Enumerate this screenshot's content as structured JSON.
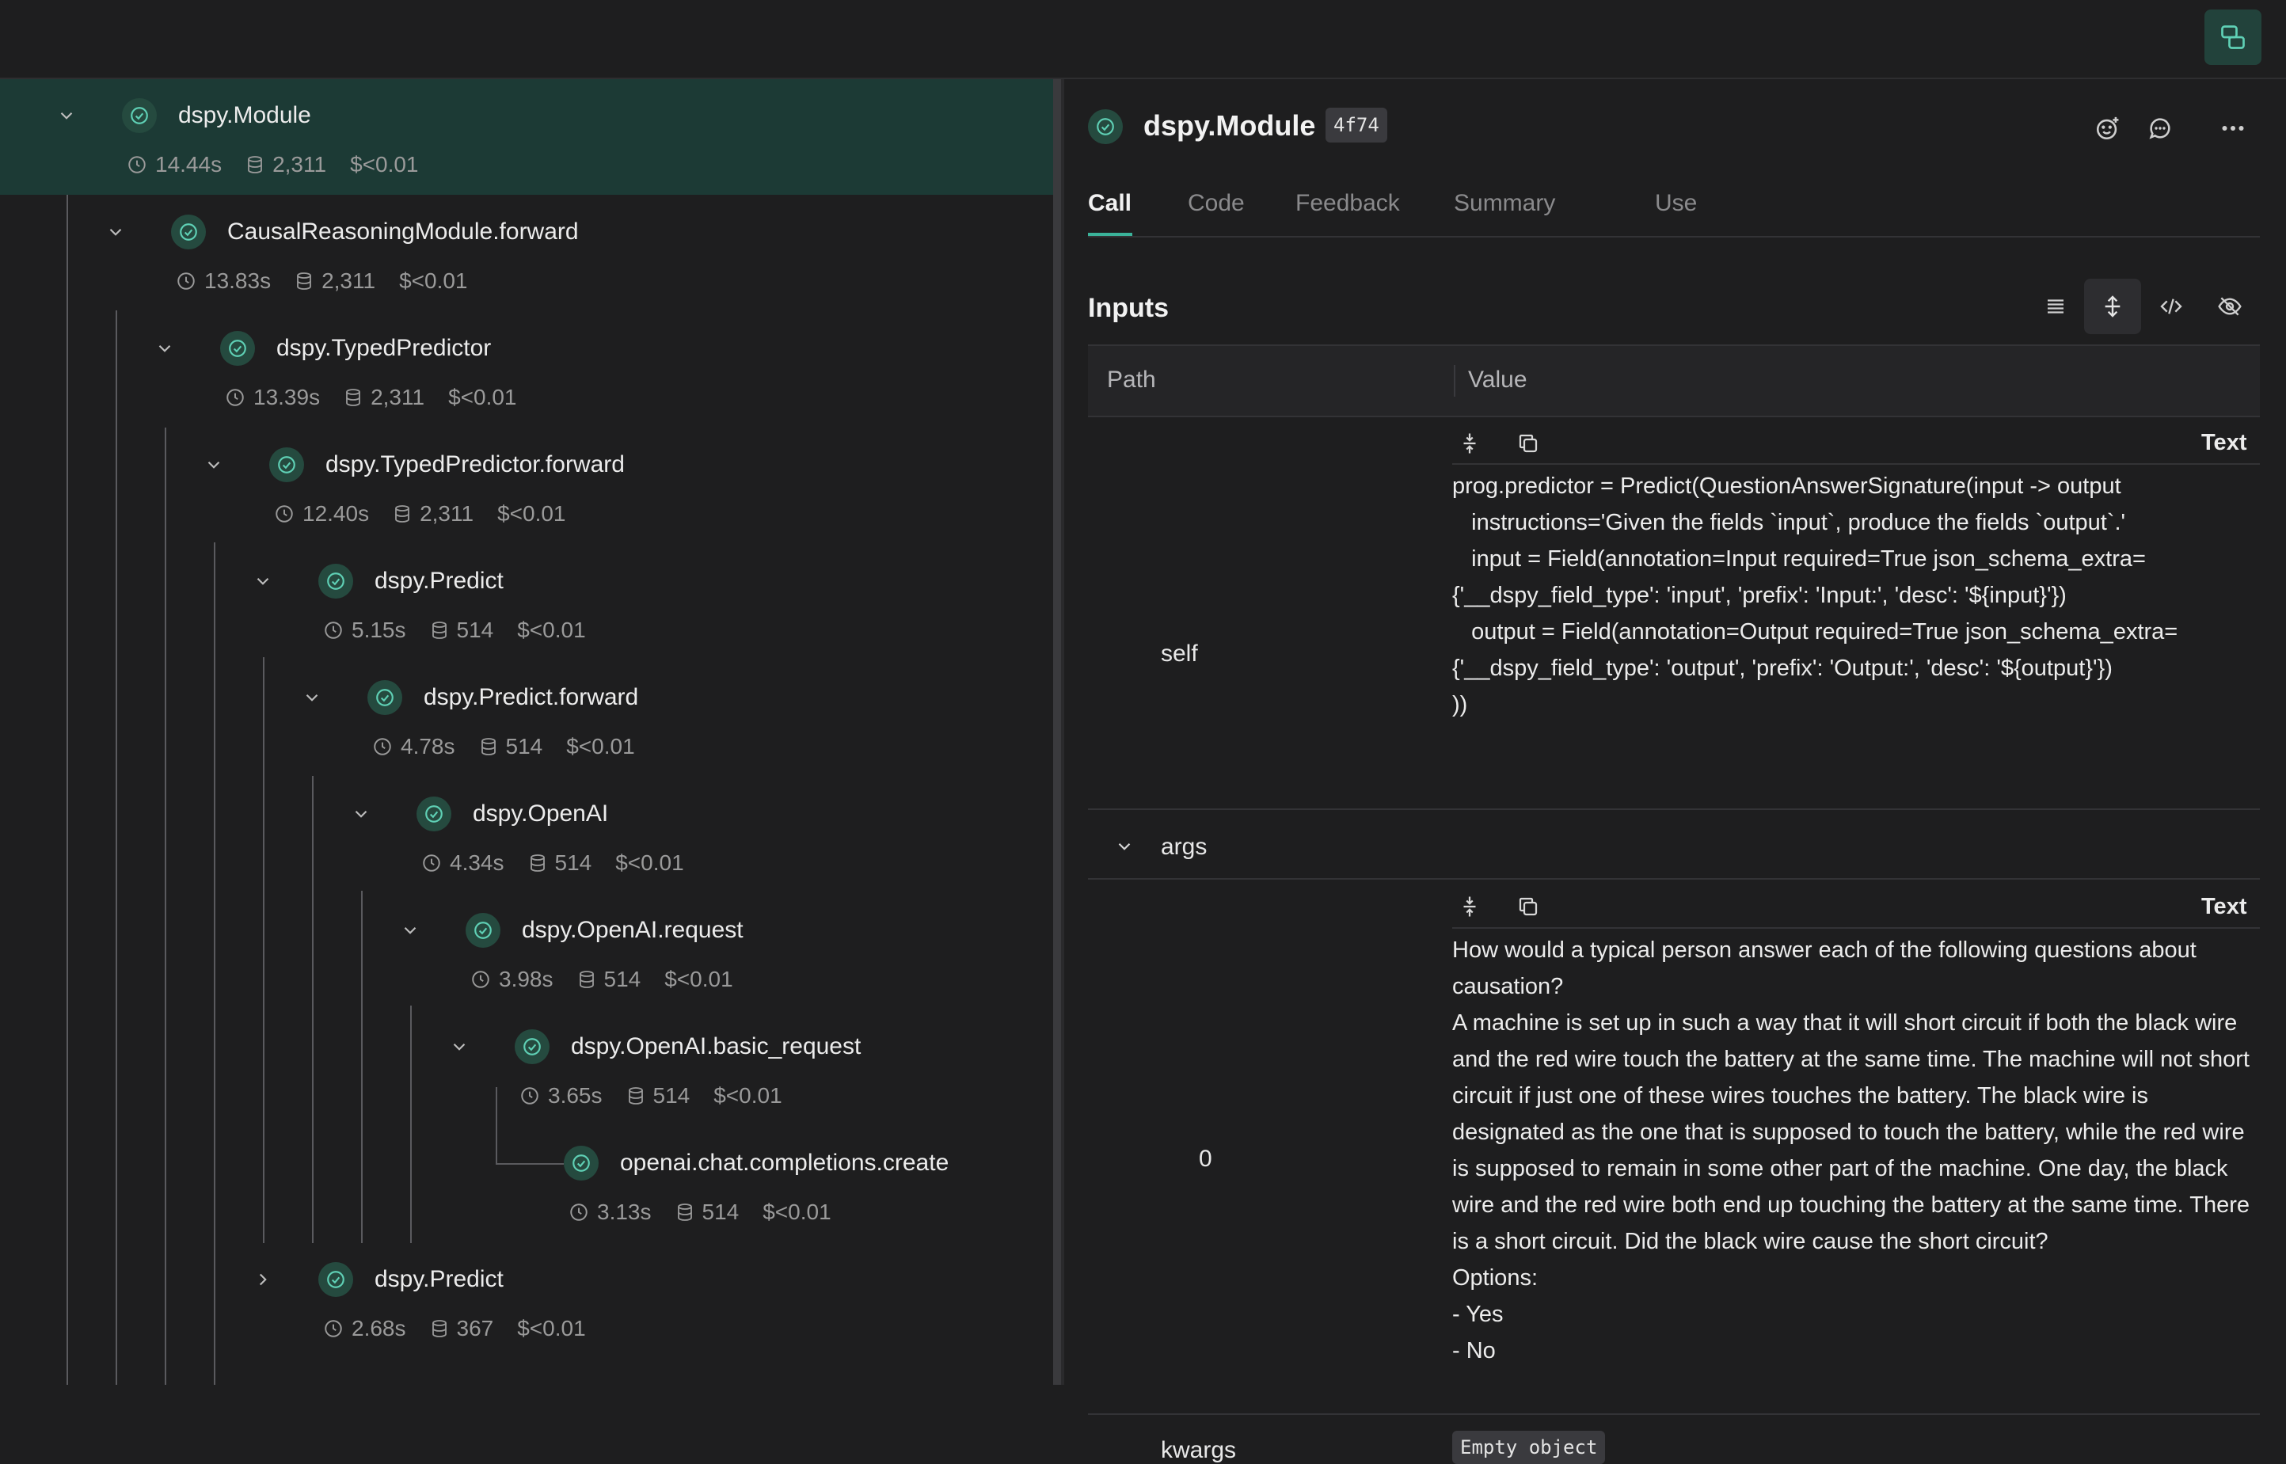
{
  "tree": {
    "nodes": [
      {
        "name": "dspy.Module",
        "time": "14.44s",
        "tokens": "2,311",
        "cost": "$<0.01",
        "expanded": true
      },
      {
        "name": "CausalReasoningModule.forward",
        "time": "13.83s",
        "tokens": "2,311",
        "cost": "$<0.01",
        "expanded": true
      },
      {
        "name": "dspy.TypedPredictor",
        "time": "13.39s",
        "tokens": "2,311",
        "cost": "$<0.01",
        "expanded": true
      },
      {
        "name": "dspy.TypedPredictor.forward",
        "time": "12.40s",
        "tokens": "2,311",
        "cost": "$<0.01",
        "expanded": true
      },
      {
        "name": "dspy.Predict",
        "time": "5.15s",
        "tokens": "514",
        "cost": "$<0.01",
        "expanded": true
      },
      {
        "name": "dspy.Predict.forward",
        "time": "4.78s",
        "tokens": "514",
        "cost": "$<0.01",
        "expanded": true
      },
      {
        "name": "dspy.OpenAI",
        "time": "4.34s",
        "tokens": "514",
        "cost": "$<0.01",
        "expanded": true
      },
      {
        "name": "dspy.OpenAI.request",
        "time": "3.98s",
        "tokens": "514",
        "cost": "$<0.01",
        "expanded": true
      },
      {
        "name": "dspy.OpenAI.basic_request",
        "time": "3.65s",
        "tokens": "514",
        "cost": "$<0.01",
        "expanded": true
      },
      {
        "name": "openai.chat.completions.create",
        "time": "3.13s",
        "tokens": "514",
        "cost": "$<0.01",
        "expanded": null
      },
      {
        "name": "dspy.Predict",
        "time": "2.68s",
        "tokens": "367",
        "cost": "$<0.01",
        "expanded": false
      }
    ]
  },
  "panel": {
    "title": "dspy.Module",
    "badge": "4f74",
    "tabs": [
      "Call",
      "Code",
      "Feedback",
      "Summary",
      "Use"
    ],
    "active_tab": "Call",
    "section_title": "Inputs",
    "table": {
      "header_path": "Path",
      "header_value": "Value",
      "rows": [
        {
          "path": "self",
          "type_label": "Text",
          "value": "prog.predictor = Predict(QuestionAnswerSignature(input -> output\n   instructions='Given the fields `input`, produce the fields `output`.'\n   input = Field(annotation=Input required=True json_schema_extra=\n{'__dspy_field_type': 'input', 'prefix': 'Input:', 'desc': '${input}'})\n   output = Field(annotation=Output required=True json_schema_extra=\n{'__dspy_field_type': 'output', 'prefix': 'Output:', 'desc': '${output}'})\n))"
        },
        {
          "path": "args"
        },
        {
          "path": "0",
          "type_label": "Text",
          "value": "How would a typical person answer each of the following questions about causation?\nA machine is set up in such a way that it will short circuit if both the black wire and the red wire touch the battery at the same time. The machine will not short circuit if just one of these wires touches the battery. The black wire is designated as the one that is supposed to touch the battery, while the red wire is supposed to remain in some other part of the machine. One day, the black wire and the red wire both end up touching the battery at the same time. There is a short circuit. Did the black wire cause the short circuit?\nOptions:\n- Yes\n- No"
        },
        {
          "path": "kwargs",
          "value": "Empty object"
        }
      ]
    }
  },
  "colors": {
    "accent": "#3bb39a",
    "selected_row": "#1c3a35",
    "background": "#1e1e1f"
  },
  "icons": [
    "compare-icon",
    "chevron-down-icon",
    "chevron-right-icon",
    "check-circle-icon",
    "clock-icon",
    "database-icon",
    "emoji-add-icon",
    "comment-icon",
    "more-icon",
    "list-icon",
    "expand-vertical-icon",
    "code-icon",
    "eye-off-icon",
    "collapse-icon",
    "copy-icon"
  ]
}
